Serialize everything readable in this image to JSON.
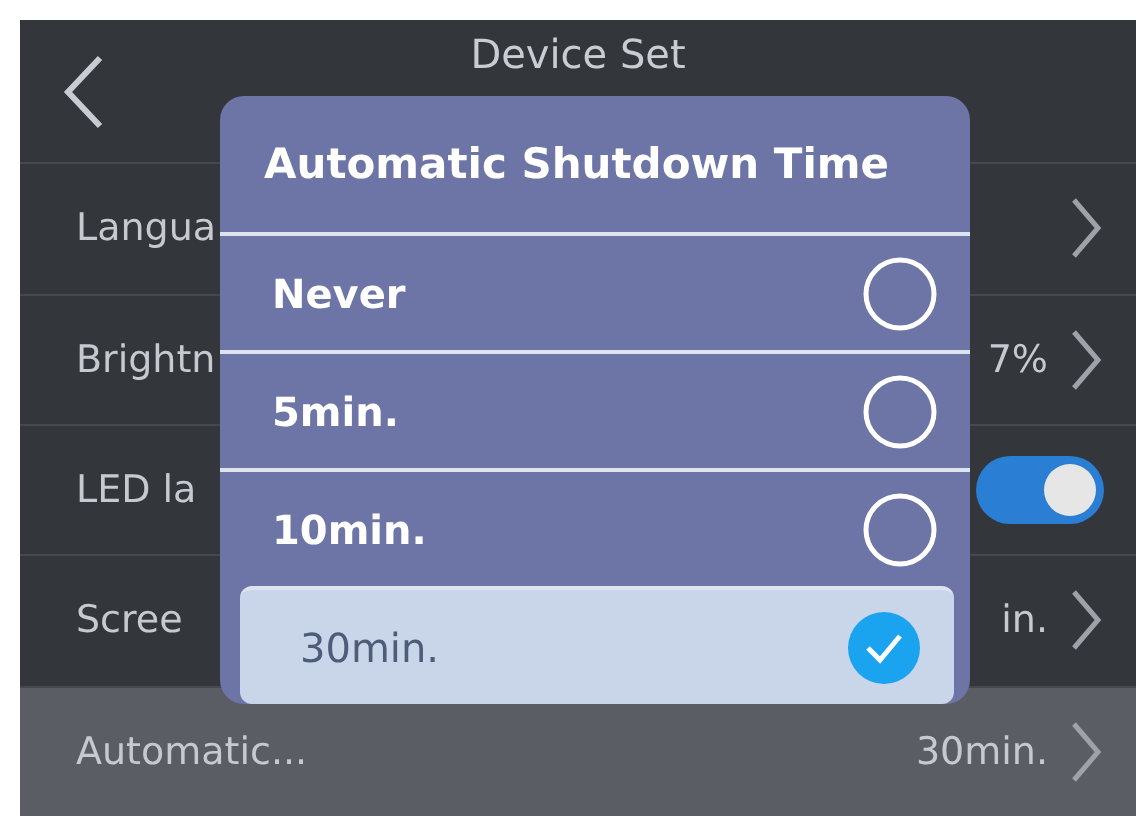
{
  "header": {
    "title": "Device Set"
  },
  "settings": [
    {
      "kind": "link",
      "label": "Langua",
      "selected": false
    },
    {
      "kind": "link",
      "label": "Brightn",
      "value": "7%",
      "selected": false
    },
    {
      "kind": "toggle",
      "label": "LED la",
      "on": true,
      "selected": false
    },
    {
      "kind": "link",
      "label": "Scree",
      "value": "in.",
      "selected": false
    },
    {
      "kind": "link",
      "label": "Automatic...",
      "value": "30min.",
      "selected": true
    }
  ],
  "dialog": {
    "title": "Automatic Shutdown Time",
    "options": [
      {
        "label": "Never",
        "selected": false
      },
      {
        "label": "5min.",
        "selected": false
      },
      {
        "label": "10min.",
        "selected": false
      },
      {
        "label": "30min.",
        "selected": true
      }
    ]
  }
}
